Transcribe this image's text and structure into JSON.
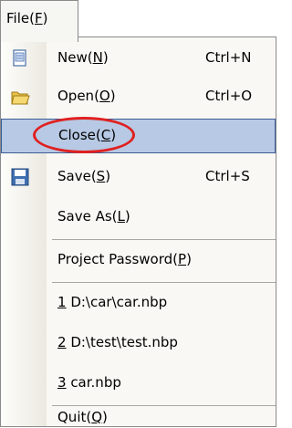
{
  "menubar": {
    "file_label": "File(",
    "file_key": "F",
    "file_tail": ")"
  },
  "items": [
    {
      "id": "new",
      "label_pre": "New(",
      "key": "N",
      "label_post": ")",
      "shortcut": "Ctrl+N",
      "icon": "new-document-icon"
    },
    {
      "id": "open",
      "label_pre": "Open(",
      "key": "O",
      "label_post": ")",
      "shortcut": "Ctrl+O",
      "icon": "open-folder-icon"
    },
    {
      "id": "close",
      "label_pre": "Close(",
      "key": "C",
      "label_post": ")",
      "shortcut": ""
    },
    {
      "id": "save",
      "label_pre": "Save(",
      "key": "S",
      "label_post": ")",
      "shortcut": "Ctrl+S",
      "icon": "floppy-disk-icon"
    },
    {
      "id": "saveas",
      "label_pre": "Save As(",
      "key": "L",
      "label_post": ")",
      "shortcut": ""
    },
    {
      "id": "password",
      "label_pre": "Project Password(",
      "key": "P",
      "label_post": ")",
      "shortcut": ""
    },
    {
      "id": "recent1",
      "key": "1",
      "label_post": " D:\\car\\car.nbp"
    },
    {
      "id": "recent2",
      "key": "2",
      "label_post": " D:\\test\\test.nbp"
    },
    {
      "id": "recent3",
      "key": "3",
      "label_post": " car.nbp"
    },
    {
      "id": "quit",
      "label_pre": "Quit(",
      "key": "Q",
      "label_post": ")"
    }
  ]
}
